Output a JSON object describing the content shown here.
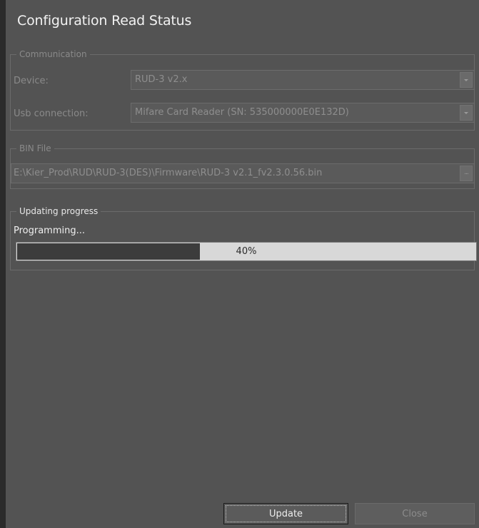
{
  "window": {
    "title": "Configuration Read Status"
  },
  "communication": {
    "legend": "Communication",
    "device_label": "Device:",
    "device_value": "RUD-3 v2.x",
    "usb_label": "Usb connection:",
    "usb_value": "Mifare Card Reader (SN: 535000000E0E132D)"
  },
  "bin_file": {
    "legend": "BIN File",
    "path": "E:\\Kier_Prod\\RUD\\RUD-3(DES)\\Firmware\\RUD-3 v2.1_fv2.3.0.56.bin",
    "browse_glyph": "..."
  },
  "progress": {
    "legend": "Updating progress",
    "status": "Programming...",
    "percent": 40,
    "percent_label": "40%"
  },
  "buttons": {
    "update_label": "Update",
    "close_label": "Close"
  },
  "colors": {
    "window_bg": "#535353",
    "progress_fill": "#3c3c3c",
    "progress_track": "#d8d8d8"
  },
  "icons": {
    "combo_arrow": "chevron-down-icon",
    "browse": "ellipsis-icon"
  }
}
